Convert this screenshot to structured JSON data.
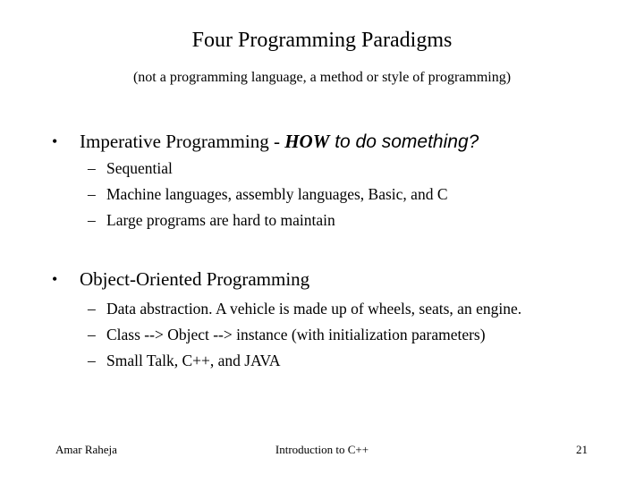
{
  "slide": {
    "title": "Four Programming Paradigms",
    "subtitle": "(not a programming language, a method or style of programming)",
    "bullets": [
      {
        "marker": "•",
        "text_plain": "Imperative Programming - ",
        "text_emphasis_bold": "HOW",
        "text_emphasis_sans": " to do something?",
        "sub_items": [
          {
            "marker": "–",
            "text": "Sequential"
          },
          {
            "marker": "–",
            "text": "Machine languages, assembly languages, Basic, and C"
          },
          {
            "marker": "–",
            "text": "Large programs are hard to maintain"
          }
        ]
      },
      {
        "marker": "•",
        "text_plain": "Object-Oriented Programming",
        "sub_items": [
          {
            "marker": "–",
            "text": "Data abstraction. A vehicle is made up of wheels, seats, an engine."
          },
          {
            "marker": "–",
            "text": "Class --> Object --> instance (with initialization parameters)"
          },
          {
            "marker": "–",
            "text": "Small Talk, C++, and JAVA"
          }
        ]
      }
    ],
    "footer": {
      "author": "Amar Raheja",
      "course": "Introduction to C++",
      "page_number": "21"
    }
  }
}
